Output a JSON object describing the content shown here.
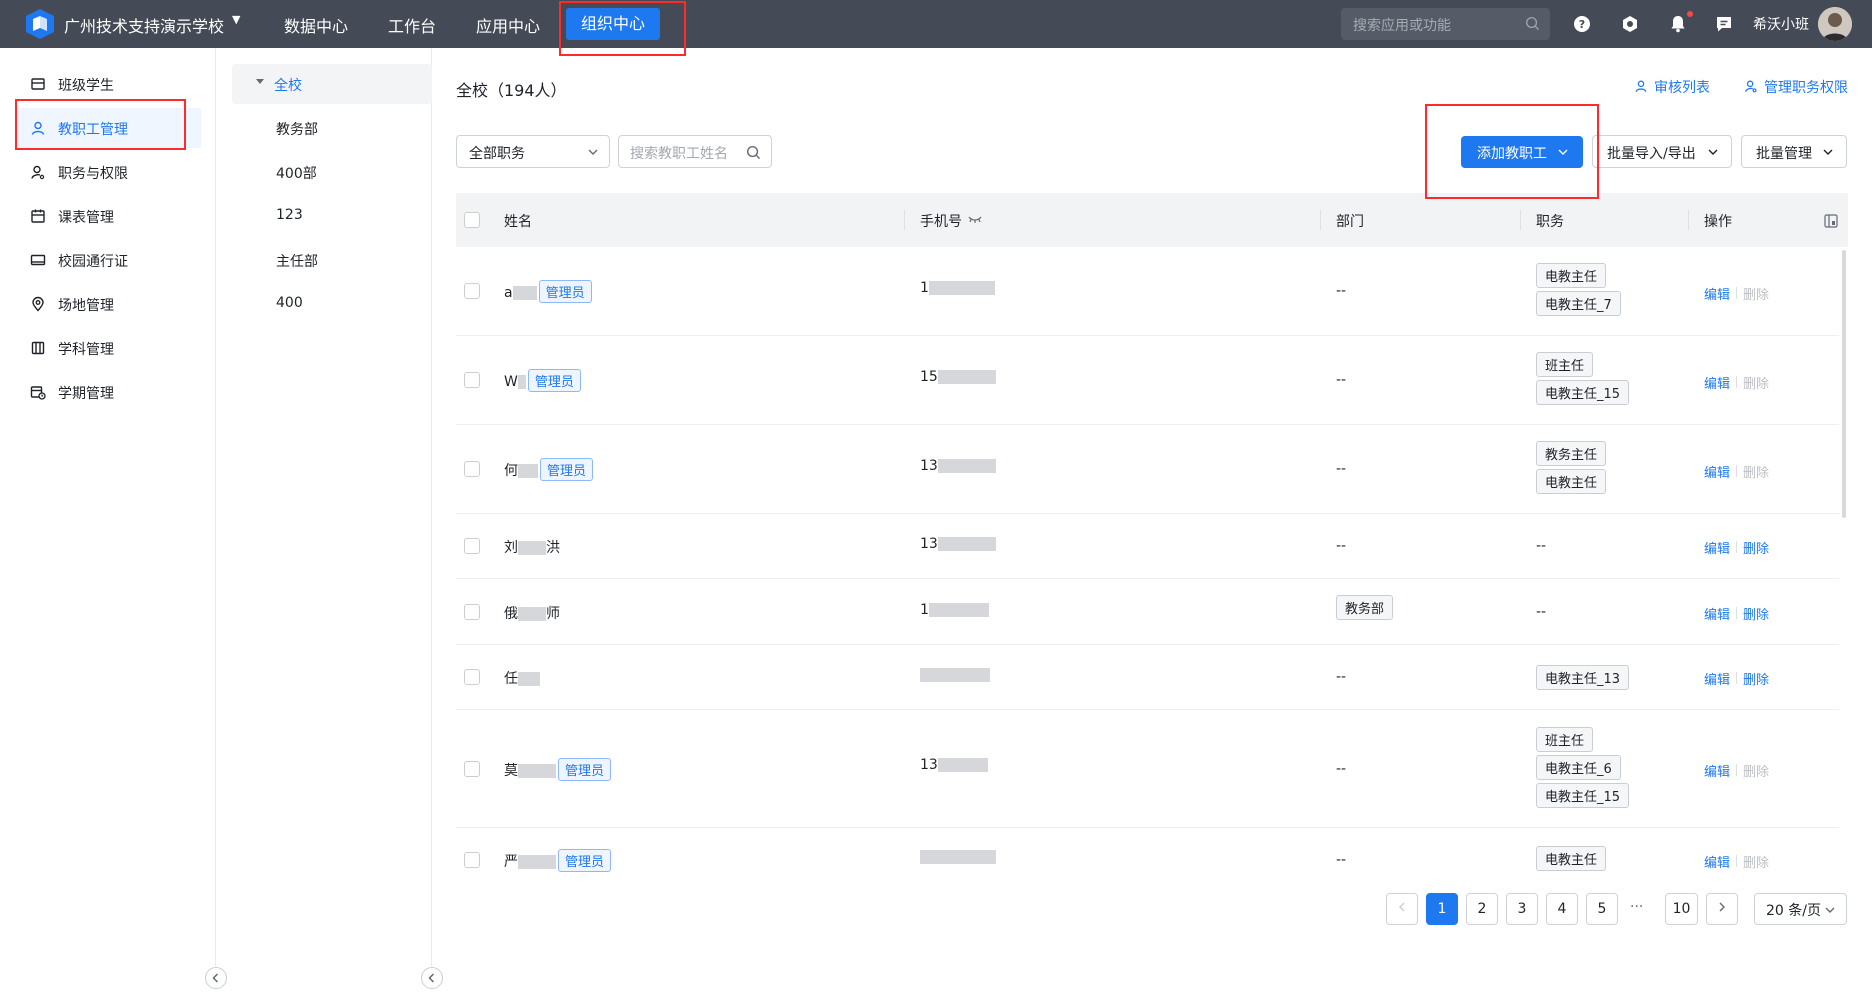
{
  "topbar": {
    "school_name": "广州技术支持演示学校",
    "nav": [
      "数据中心",
      "工作台",
      "应用中心"
    ],
    "nav_active": "组织中心",
    "search_placeholder": "搜索应用或功能",
    "username": "希沃小班"
  },
  "sidebar": {
    "items": [
      {
        "label": "班级学生",
        "icon": "class-students-icon"
      },
      {
        "label": "教职工管理",
        "icon": "user-icon"
      },
      {
        "label": "职务与权限",
        "icon": "user-key-icon"
      },
      {
        "label": "课表管理",
        "icon": "calendar-icon"
      },
      {
        "label": "校园通行证",
        "icon": "card-icon"
      },
      {
        "label": "场地管理",
        "icon": "location-pin-icon"
      },
      {
        "label": "学科管理",
        "icon": "book-icon"
      },
      {
        "label": "学期管理",
        "icon": "calendar-clock-icon"
      }
    ],
    "active_index": 1
  },
  "departments": {
    "root": "全校",
    "items": [
      "教务部",
      "400部",
      "123",
      "主任部",
      "400"
    ]
  },
  "main": {
    "title": "全校（194人）",
    "review_list": "审核列表",
    "manage_perms": "管理职务权限",
    "filter_position": "全部职务",
    "search_placeholder": "搜索教职工姓名",
    "add_staff": "添加教职工",
    "batch_import": "批量导入/导出",
    "batch_manage": "批量管理"
  },
  "table": {
    "headers": {
      "name": "姓名",
      "phone": "手机号",
      "dept": "部门",
      "position": "职务",
      "ops": "操作"
    },
    "edit_label": "编辑",
    "delete_label": "删除",
    "rows": [
      {
        "name_prefix": "a",
        "name_suffix": "",
        "admin_tag": "管理员",
        "phone_prefix": "1",
        "dept": "--",
        "positions": [
          "电教主任",
          "电教主任_7"
        ],
        "delete_enabled": false
      },
      {
        "name_prefix": "W",
        "name_suffix": "",
        "admin_tag": "管理员",
        "phone_prefix": "15",
        "dept": "--",
        "positions": [
          "班主任",
          "电教主任_15"
        ],
        "delete_enabled": false
      },
      {
        "name_prefix": "何",
        "name_suffix": "",
        "admin_tag": "管理员",
        "phone_prefix": "13",
        "dept": "--",
        "positions": [
          "教务主任",
          "电教主任"
        ],
        "delete_enabled": false
      },
      {
        "name_prefix": "刘",
        "name_suffix": "洪",
        "admin_tag": "",
        "phone_prefix": "13",
        "dept": "--",
        "positions": [],
        "no_position": "--",
        "delete_enabled": true
      },
      {
        "name_prefix": "俄",
        "name_suffix": "师",
        "admin_tag": "",
        "phone_prefix": "1",
        "dept_tag": "教务部",
        "dept": "",
        "positions": [],
        "no_position": "--",
        "delete_enabled": true
      },
      {
        "name_prefix": "任",
        "name_suffix": "",
        "admin_tag": "",
        "phone_prefix": "",
        "dept": "--",
        "positions": [
          "电教主任_13"
        ],
        "delete_enabled": true
      },
      {
        "name_prefix": "莫",
        "name_suffix": "",
        "admin_tag": "管理员",
        "phone_prefix": "13",
        "dept": "--",
        "positions": [
          "班主任",
          "电教主任_6",
          "电教主任_15"
        ],
        "delete_enabled": false
      },
      {
        "name_prefix": "严",
        "name_suffix": "",
        "admin_tag": "管理员",
        "phone_prefix": "",
        "dept": "--",
        "positions": [
          "电教主任"
        ],
        "delete_enabled": false
      }
    ]
  },
  "pagination": {
    "pages": [
      "1",
      "2",
      "3",
      "4",
      "5"
    ],
    "dots": "···",
    "last": "10",
    "current": "1",
    "page_size": "20 条/页"
  },
  "colors": {
    "topbar": "#444b57",
    "accent": "#1e78f0",
    "highlight": "#ff2a2a"
  }
}
